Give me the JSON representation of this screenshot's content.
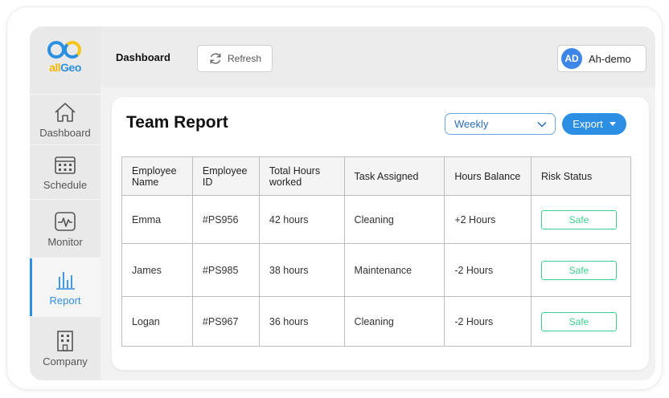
{
  "brand": {
    "logo_text_all": "all",
    "logo_text_geo": "Geo"
  },
  "sidebar": {
    "items": [
      {
        "label": "Dashboard",
        "icon": "home-icon"
      },
      {
        "label": "Schedule",
        "icon": "calendar-icon"
      },
      {
        "label": "Monitor",
        "icon": "monitor-icon"
      },
      {
        "label": "Report",
        "icon": "bar-chart-icon",
        "active": true
      },
      {
        "label": "Company",
        "icon": "building-icon"
      }
    ]
  },
  "topbar": {
    "breadcrumb": "Dashboard",
    "refresh_label": "Refresh",
    "user_initials": "AD",
    "user_name": "Ah-demo"
  },
  "report": {
    "title": "Team Report",
    "period": "Weekly",
    "export_label": "Export",
    "columns": [
      "Employee Name",
      "Employee ID",
      "Total Hours worked",
      "Task Assigned",
      "Hours Balance",
      "Risk Status"
    ],
    "rows": [
      {
        "name": "Emma",
        "id": "#PS956",
        "hours": "42 hours",
        "task": "Cleaning",
        "balance": "+2 Hours",
        "status": "Safe"
      },
      {
        "name": "James",
        "id": "#PS985",
        "hours": "38 hours",
        "task": "Maintenance",
        "balance": "-2 Hours",
        "status": "Safe"
      },
      {
        "name": "Logan",
        "id": "#PS967",
        "hours": "36 hours",
        "task": "Cleaning",
        "balance": "-2 Hours",
        "status": "Safe"
      }
    ]
  },
  "colors": {
    "accent": "#2d8fe3",
    "safe": "#3ccf8e",
    "sidebar_bg": "#e9e9e9"
  }
}
